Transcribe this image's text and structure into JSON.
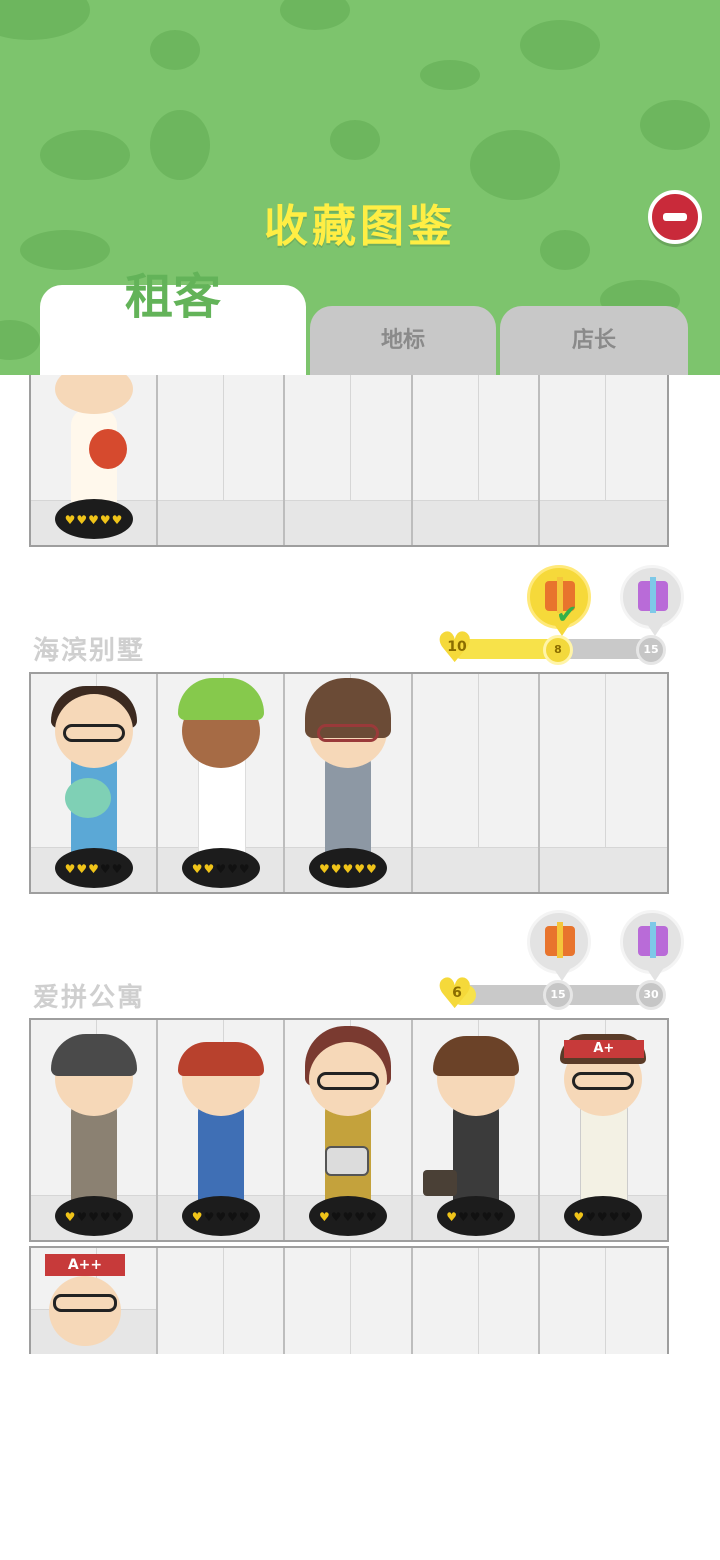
{
  "header": {
    "title": "收藏图鉴",
    "close_icon": "minus-circle-icon",
    "bg_color": "#7dc46d",
    "title_color": "#ffee44"
  },
  "tabs": [
    {
      "label": "租客",
      "active": true
    },
    {
      "label": "地标",
      "active": false
    },
    {
      "label": "店长",
      "active": false
    }
  ],
  "sections": [
    {
      "name": "",
      "slots": [
        {
          "unlocked": true,
          "hearts": 5,
          "hearts_max": 5,
          "character": "tenant-with-noodle-bowl"
        },
        {
          "unlocked": false
        },
        {
          "unlocked": false
        },
        {
          "unlocked": false
        },
        {
          "unlocked": false
        }
      ]
    },
    {
      "name": "海滨别墅",
      "progress": {
        "start": 10,
        "current": 8,
        "milestones": [
          8,
          15
        ],
        "filled_fraction": 0.55
      },
      "rewards": [
        {
          "milestone": 8,
          "icon": "gift-orange-icon",
          "claimed": true
        },
        {
          "milestone": 15,
          "icon": "gift-purple-icon",
          "claimed": false
        }
      ],
      "slots": [
        {
          "unlocked": true,
          "hearts": 3,
          "hearts_max": 5,
          "character": "father-with-baby"
        },
        {
          "unlocked": true,
          "hearts": 2,
          "hearts_max": 5,
          "character": "kid-green-beanie"
        },
        {
          "unlocked": true,
          "hearts": 5,
          "hearts_max": 5,
          "character": "girl-with-teddy"
        },
        {
          "unlocked": false
        },
        {
          "unlocked": false
        }
      ]
    },
    {
      "name": "爱拼公寓",
      "progress": {
        "start": 6,
        "current": 6,
        "milestones": [
          15,
          30
        ],
        "filled_fraction": 0.12
      },
      "rewards": [
        {
          "milestone": 15,
          "icon": "gift-orange-icon",
          "claimed": false
        },
        {
          "milestone": 30,
          "icon": "gift-purple-icon",
          "claimed": false
        }
      ],
      "slots": [
        {
          "unlocked": true,
          "hearts": 1,
          "hearts_max": 5,
          "character": "boy-with-paper-bag"
        },
        {
          "unlocked": true,
          "hearts": 1,
          "hearts_max": 5,
          "character": "girl-in-overalls"
        },
        {
          "unlocked": true,
          "hearts": 1,
          "hearts_max": 5,
          "character": "girl-with-camera"
        },
        {
          "unlocked": true,
          "hearts": 1,
          "hearts_max": 5,
          "character": "tired-man-briefcase"
        },
        {
          "unlocked": true,
          "hearts": 1,
          "hearts_max": 5,
          "character": "student-a-plus",
          "headband_text": "A+"
        },
        {
          "unlocked": true,
          "hearts": 0,
          "hearts_max": 5,
          "character": "student-a-plus-plus",
          "headband_text": "A++"
        },
        {
          "unlocked": false
        },
        {
          "unlocked": false
        },
        {
          "unlocked": false
        },
        {
          "unlocked": false
        }
      ]
    }
  ]
}
